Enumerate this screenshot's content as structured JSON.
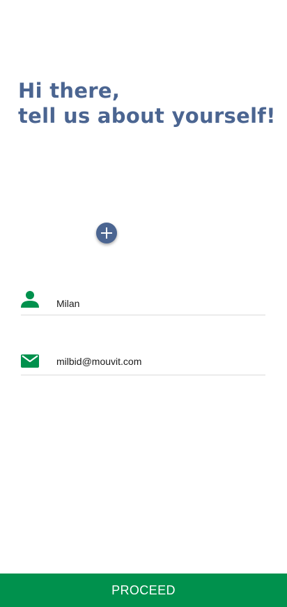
{
  "greeting": {
    "line1": "Hi there,",
    "line2": "tell us about yourself!"
  },
  "avatar": {
    "add_icon": "plus-icon"
  },
  "form": {
    "name": {
      "icon": "person-icon",
      "value": "Milan"
    },
    "email": {
      "icon": "envelope-icon",
      "value": "milbid@mouvit.com"
    }
  },
  "proceed_label": "PROCEED",
  "colors": {
    "heading": "#4b6591",
    "accent_green": "#00914d",
    "divider": "#dadada",
    "add_button": "#4b6591"
  }
}
